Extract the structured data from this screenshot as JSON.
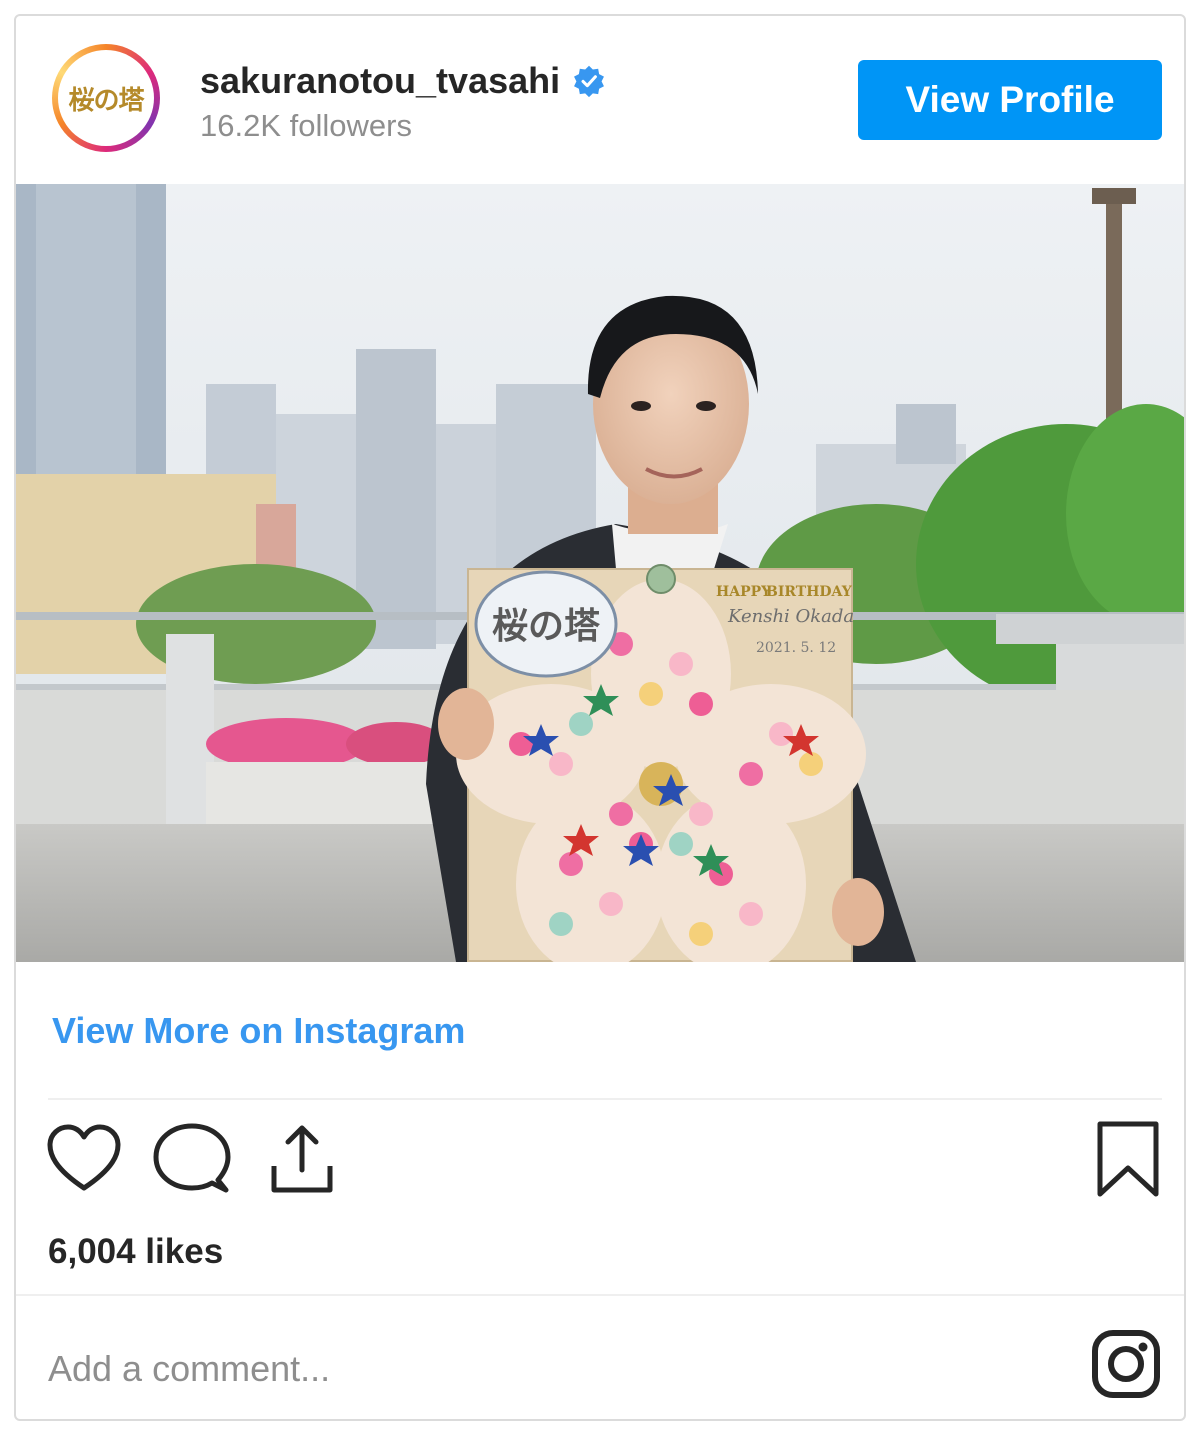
{
  "post": {
    "username": "sakuranotou_tvasahi",
    "followers": "16.2K followers",
    "avatar_logo_text": "桜の塔",
    "view_profile_label": "View Profile",
    "photo": {
      "board_title_text": "桜の塔",
      "board_caption_lines": [
        "HAPPY",
        "BIRTHDAY",
        "Kenshi Okada",
        "2021. 5. 12"
      ]
    },
    "view_more_label": "View More on Instagram",
    "likes": "6,004 likes",
    "comment_placeholder": "Add a comment..."
  },
  "icons": [
    "verified-icon",
    "heart-icon",
    "comment-icon",
    "share-icon",
    "bookmark-icon",
    "instagram-icon"
  ],
  "colors": {
    "accent_button": "#0095f6",
    "link": "#3897f0",
    "verified": "#3897f0",
    "muted_text": "#8e8e8e",
    "border": "#dbdbdb"
  }
}
